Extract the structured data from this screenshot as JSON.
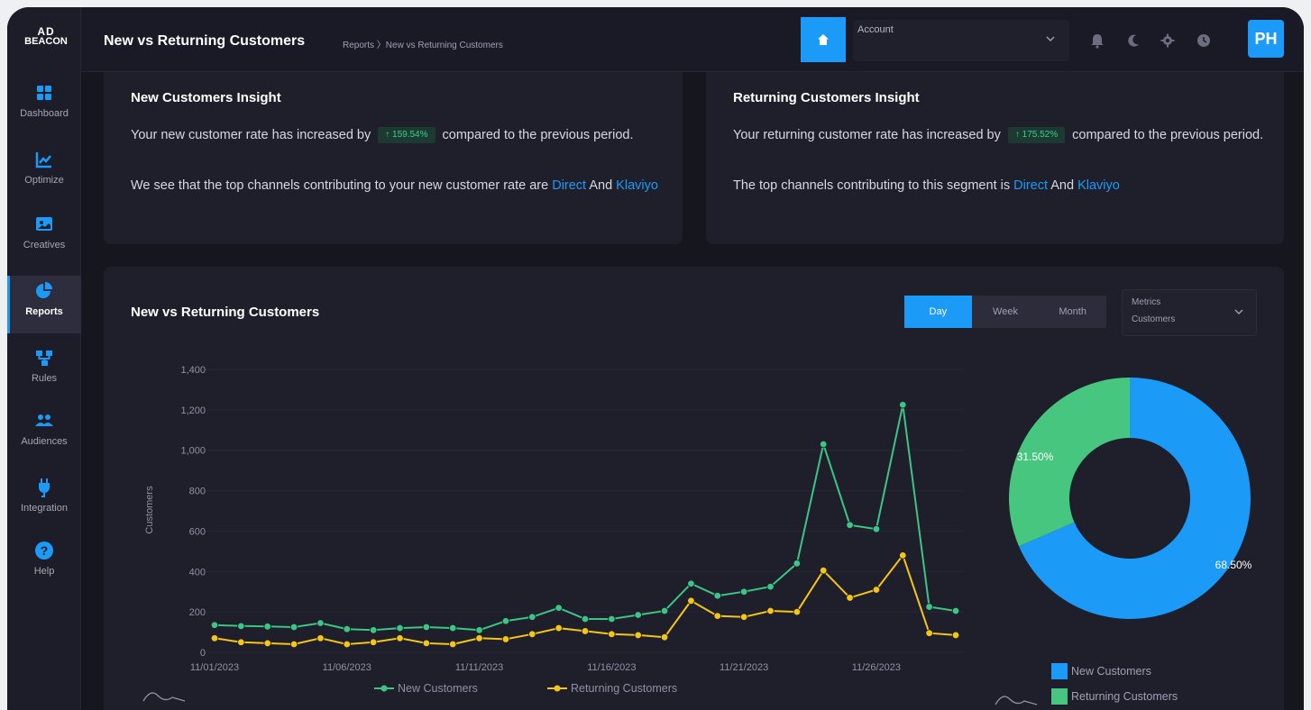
{
  "brand": {
    "line1": "AD",
    "line2": "BEACON"
  },
  "sidebar": {
    "items": [
      {
        "label": "Dashboard",
        "icon": "grid-icon"
      },
      {
        "label": "Optimize",
        "icon": "trend-chart-icon"
      },
      {
        "label": "Creatives",
        "icon": "image-icon"
      },
      {
        "label": "Reports",
        "icon": "pie-chart-icon",
        "active": true
      },
      {
        "label": "Rules",
        "icon": "flow-icon"
      },
      {
        "label": "Audiences",
        "icon": "people-icon"
      },
      {
        "label": "Integration",
        "icon": "plug-icon"
      },
      {
        "label": "Help",
        "icon": "help-icon"
      }
    ]
  },
  "header": {
    "title": "New vs Returning Customers",
    "breadcrumb": "Reports 〉New vs Returning Customers",
    "account_label": "Account",
    "avatar": "PH"
  },
  "new_insight": {
    "title": "New Customers Insight",
    "l1a": "Your new customer rate has increased by",
    "pct": "↑ 159.54%",
    "l1b": "compared to the previous period.",
    "l2": "We see that the top channels contributing to your new customer rate are",
    "ch1": "Direct",
    "and": "And",
    "ch2": "Klaviyo"
  },
  "returning_insight": {
    "title": "Returning Customers Insight",
    "l1a": "Your returning customer rate has increased by",
    "pct": "↑ 175.52%",
    "l1b": "compared to the previous period.",
    "l2": "The top channels contributing to this segment is",
    "ch1": "Direct",
    "and": "And",
    "ch2": "Klaviyo"
  },
  "chart_section": {
    "title": "New vs Returning Customers",
    "periods": [
      "Day",
      "Week",
      "Month"
    ],
    "selected_period": "Day",
    "metrics_label": "Metrics",
    "metrics_value": "Customers"
  },
  "colors": {
    "new": "#3cc584",
    "returning": "#f5c518",
    "accent": "#1b9af7",
    "donut_new": "#1b9af7",
    "donut_returning": "#46c67e"
  },
  "chart_data": [
    {
      "type": "line",
      "ylabel": "Customers",
      "ylim": [
        0,
        1400
      ],
      "yticks": [
        0,
        200,
        400,
        600,
        800,
        1000,
        1200,
        1400
      ],
      "x_tick_labels": [
        "11/01/2023",
        "11/06/2023",
        "11/11/2023",
        "11/16/2023",
        "11/21/2023",
        "11/26/2023"
      ],
      "x_tick_index": [
        0,
        5,
        10,
        15,
        20,
        25
      ],
      "series": [
        {
          "name": "New Customers",
          "values": [
            135,
            130,
            128,
            125,
            145,
            115,
            110,
            120,
            125,
            120,
            110,
            155,
            175,
            220,
            165,
            165,
            185,
            205,
            340,
            280,
            300,
            325,
            440,
            1030,
            630,
            610,
            1225,
            225,
            205
          ]
        },
        {
          "name": "Returning Customers",
          "values": [
            70,
            50,
            45,
            40,
            70,
            40,
            50,
            70,
            45,
            40,
            70,
            65,
            90,
            120,
            105,
            90,
            85,
            75,
            255,
            180,
            175,
            205,
            200,
            405,
            270,
            310,
            480,
            95,
            85
          ]
        }
      ],
      "grid": true,
      "legend": "bottom"
    },
    {
      "type": "pie",
      "donut": true,
      "labels": [
        "New Customers",
        "Returning Customers"
      ],
      "values": [
        68.5,
        31.5
      ],
      "data_labels": [
        "68.50%",
        "31.50%"
      ],
      "legend": "bottom"
    }
  ]
}
